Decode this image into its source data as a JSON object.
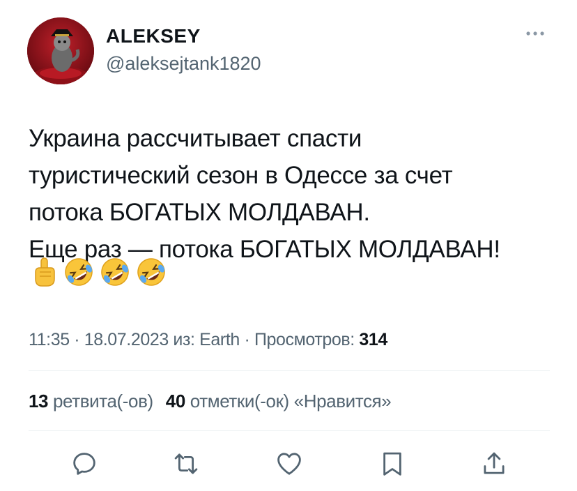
{
  "author": {
    "name": "ALEKSEY",
    "handle": "@aleksejtank1820"
  },
  "tweet": {
    "text": "Украина рассчитывает спасти\nтуристический сезон в Одессе за счет\nпотока БОГАТЫХ МОЛДАВАН.\nЕще раз — потока БОГАТЫХ МОЛДАВАН!",
    "emojis": [
      "☝",
      "🤣",
      "🤣",
      "🤣"
    ]
  },
  "meta": {
    "time": "11:35",
    "sep1": " · ",
    "date": "18.07.2023",
    "source_prefix": " из: ",
    "source": "Earth",
    "sep2": " · ",
    "views_label": "Просмотров: ",
    "views_count": "314"
  },
  "stats": {
    "retweets_count": "13",
    "retweets_label": "ретвита(-ов)",
    "likes_count": "40",
    "likes_label": "отметки(-ок) «Нравится»"
  },
  "icons": {
    "more": "more-icon",
    "reply": "reply-icon",
    "retweet": "retweet-icon",
    "like": "heart-icon",
    "bookmark": "bookmark-icon",
    "share": "share-icon"
  },
  "colors": {
    "text": "#0f1419",
    "secondary": "#536471",
    "divider": "#eff3f4",
    "avatar_bg": "#7a0c14"
  }
}
